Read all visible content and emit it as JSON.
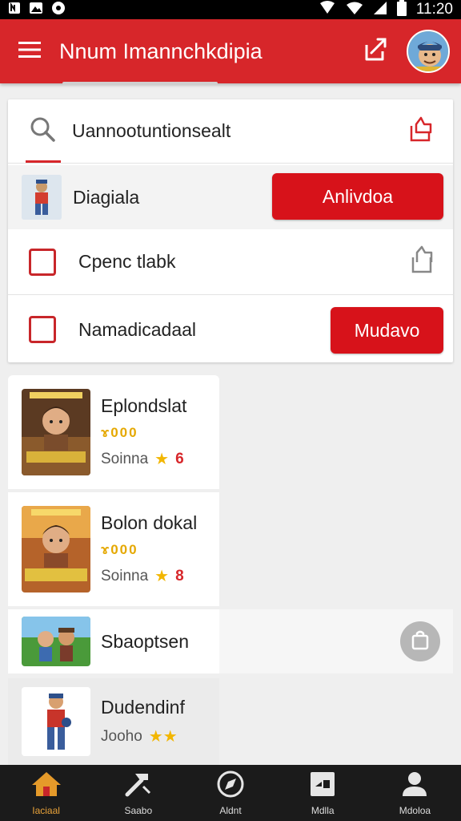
{
  "status_bar": {
    "time": "11:20"
  },
  "header": {
    "title": "Nnum Imannchkdipia"
  },
  "search_row": {
    "text": "Uannootuntionsealt"
  },
  "diagiala_row": {
    "label": "Diagiala",
    "button": "Anlivdoa"
  },
  "check_row_1": {
    "label": "Cpenc tlabk"
  },
  "check_row_2": {
    "label": "Namadicadaal",
    "button": "Mudavo"
  },
  "games": [
    {
      "title": "Eplondslat",
      "price": "ɤ000",
      "meta": "Soinna",
      "rating": "6"
    },
    {
      "title": "Bolon dokal",
      "price": "ɤ000",
      "meta": "Soinna",
      "rating": "8"
    },
    {
      "title": "Sbaoptsen"
    },
    {
      "title": "Dudendinf",
      "meta": "Jooho"
    }
  ],
  "bottom_nav": [
    {
      "label": "Iaciaal",
      "icon": "home-icon"
    },
    {
      "label": "Saabo",
      "icon": "hammer-icon"
    },
    {
      "label": "Aldnt",
      "icon": "compass-icon"
    },
    {
      "label": "Mdlla",
      "icon": "image-icon"
    },
    {
      "label": "Mdoloa",
      "icon": "person-icon"
    }
  ],
  "colors": {
    "brand_red": "#d7262a",
    "button_red": "#d7121a",
    "star": "#f2b600"
  }
}
